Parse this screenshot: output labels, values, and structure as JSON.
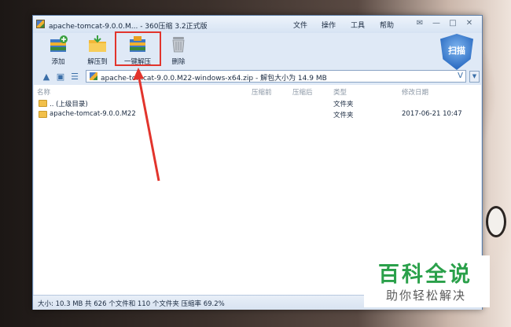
{
  "window": {
    "title": "apache-tomcat-9.0.0.M... - 360压缩 3.2正式版",
    "menu": [
      "文件",
      "操作",
      "工具",
      "帮助"
    ]
  },
  "toolbar": {
    "add_label": "添加",
    "extract_to_label": "解压到",
    "one_click_extract_label": "一键解压",
    "delete_label": "删除",
    "scan_label": "扫描"
  },
  "address": {
    "path": "apache-tomcat-9.0.0.M22-windows-x64.zip - 解包大小为 14.9 MB",
    "v": "V"
  },
  "columns": {
    "name": "名称",
    "compressed": "压缩前",
    "after": "压缩后",
    "type": "类型",
    "modified": "修改日期"
  },
  "rows": [
    {
      "name": ".. (上级目录)",
      "type": "文件夹",
      "date": ""
    },
    {
      "name": "apache-tomcat-9.0.0.M22",
      "type": "文件夹",
      "date": "2017-06-21 10:47"
    }
  ],
  "status": "大小: 10.3 MB 共 626 个文件和 110 个文件夹 压缩率 69.2%",
  "brand": {
    "title": "百科全说",
    "slogan": "助你轻松解决"
  },
  "colors": {
    "highlight": "#e2342c",
    "brand_green": "#2aa04a"
  }
}
